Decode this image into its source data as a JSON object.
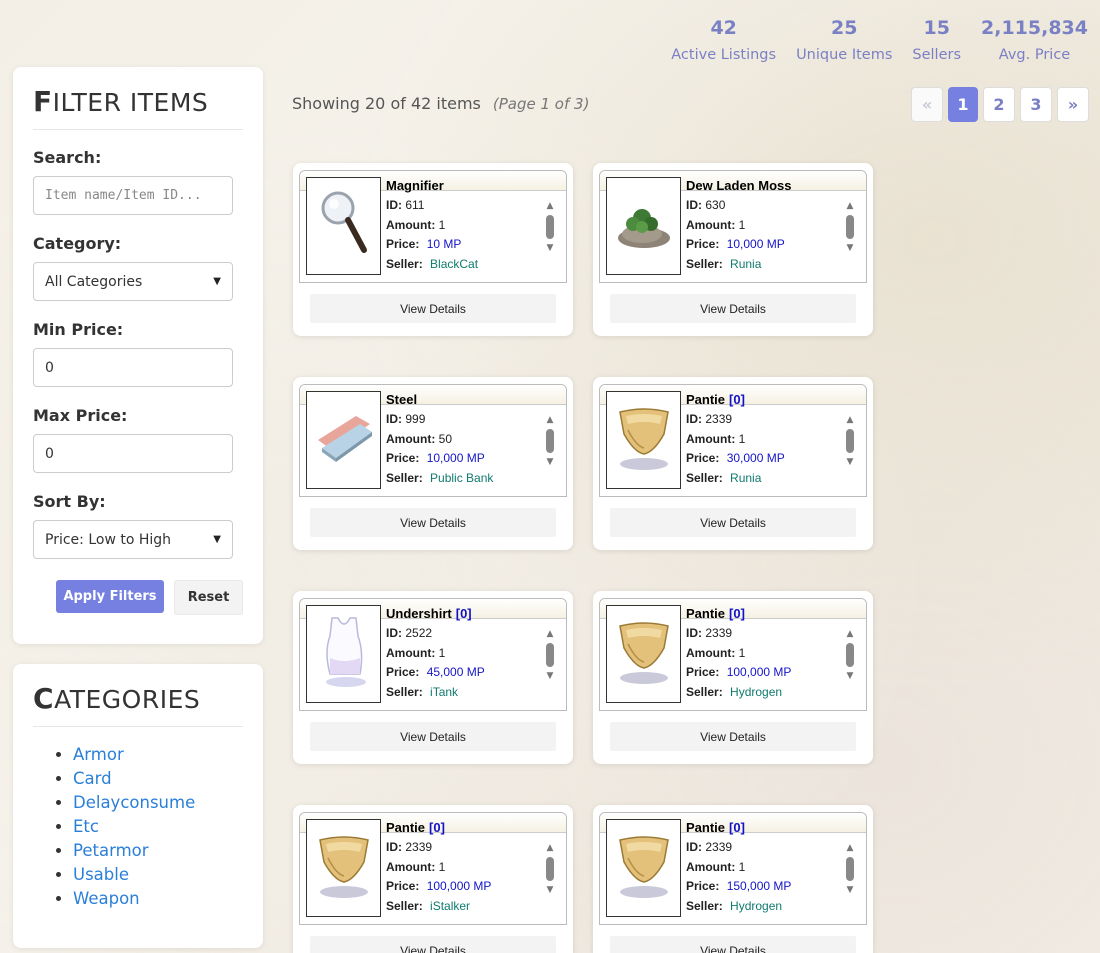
{
  "stats": [
    {
      "value": "42",
      "label": "Active Listings"
    },
    {
      "value": "25",
      "label": "Unique Items"
    },
    {
      "value": "15",
      "label": "Sellers"
    },
    {
      "value": "2,115,834",
      "label": "Avg. Price"
    }
  ],
  "filter": {
    "title_first": "F",
    "title_rest": "ILTER ITEMS",
    "search_label": "Search:",
    "search_placeholder": "Item name/Item ID...",
    "category_label": "Category:",
    "category_value": "All Categories",
    "min_label": "Min Price:",
    "min_value": "0",
    "max_label": "Max Price:",
    "max_value": "0",
    "sort_label": "Sort By:",
    "sort_value": "Price: Low to High",
    "apply_label": "Apply Filters",
    "reset_label": "Reset"
  },
  "categories": {
    "title_first": "C",
    "title_rest": "ATEGORIES",
    "items": [
      "Armor",
      "Card",
      "Delayconsume",
      "Etc",
      "Petarmor",
      "Usable",
      "Weapon"
    ]
  },
  "results": {
    "showing": "Showing 20 of 42 items",
    "page_info": "(Page 1 of 3)"
  },
  "pagination": {
    "prev": "«",
    "pages": [
      "1",
      "2",
      "3"
    ],
    "next": "»",
    "current": "1"
  },
  "card_labels": {
    "id": "ID:",
    "amount": "Amount:",
    "price": "Price:",
    "seller": "Seller:",
    "details": "View Details"
  },
  "items": [
    {
      "name": "Magnifier",
      "slots": "",
      "id": "611",
      "amount": "1",
      "price": "10 MP",
      "seller": "BlackCat",
      "icon": "magnifier-icon"
    },
    {
      "name": "Dew Laden Moss",
      "slots": "",
      "id": "630",
      "amount": "1",
      "price": "10,000 MP",
      "seller": "Runia",
      "icon": "moss-icon"
    },
    {
      "name": "Steel",
      "slots": "",
      "id": "999",
      "amount": "50",
      "price": "10,000 MP",
      "seller": "Public Bank",
      "icon": "steel-icon"
    },
    {
      "name": "Pantie",
      "slots": "[0]",
      "id": "2339",
      "amount": "1",
      "price": "30,000 MP",
      "seller": "Runia",
      "icon": "pantie-icon"
    },
    {
      "name": "Undershirt",
      "slots": "[0]",
      "id": "2522",
      "amount": "1",
      "price": "45,000 MP",
      "seller": "iTank",
      "icon": "undershirt-icon"
    },
    {
      "name": "Pantie",
      "slots": "[0]",
      "id": "2339",
      "amount": "1",
      "price": "100,000 MP",
      "seller": "Hydrogen",
      "icon": "pantie-icon"
    },
    {
      "name": "Pantie",
      "slots": "[0]",
      "id": "2339",
      "amount": "1",
      "price": "100,000 MP",
      "seller": "iStalker",
      "icon": "pantie-icon"
    },
    {
      "name": "Pantie",
      "slots": "[0]",
      "id": "2339",
      "amount": "1",
      "price": "150,000 MP",
      "seller": "Hydrogen",
      "icon": "pantie-icon"
    }
  ]
}
